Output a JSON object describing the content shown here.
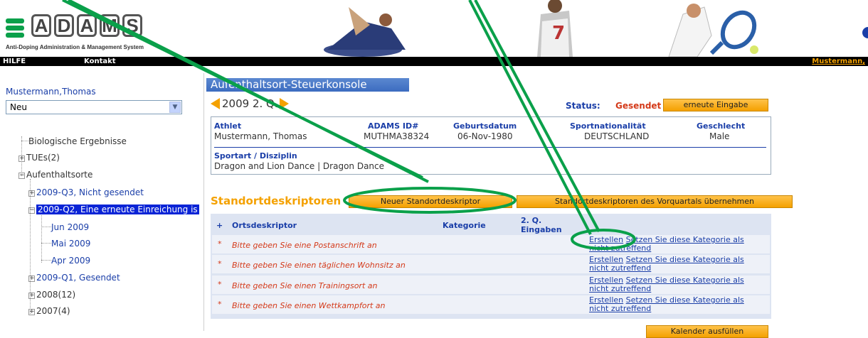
{
  "header": {
    "logo_letters": [
      "A",
      "D",
      "A",
      "M",
      "S"
    ],
    "logo_subtitle": "Anti-Doping Administration & Management System",
    "nav_help": "HILFE",
    "nav_contact": "Kontakt",
    "nav_user": "Mustermann,"
  },
  "sidebar": {
    "user_name": "Mustermann,Thomas",
    "status_select_value": "Neu",
    "tree": {
      "bio": "Biologische Ergebnisse",
      "tues": "TUEs(2)",
      "whereabouts": "Aufenthaltsorte",
      "q3": "2009-Q3, Nicht gesendet",
      "q2": "2009-Q2, Eine erneute Einreichung is",
      "jun": "Jun 2009",
      "mai": "Mai 2009",
      "apr": "Apr 2009",
      "q1": "2009-Q1, Gesendet",
      "y2008": "2008(12)",
      "y2007": "2007(4)"
    }
  },
  "main": {
    "title": "Aufenthaltsort-Steuerkonsole",
    "period": "2009 2. Q.",
    "status_label": "Status:",
    "status_value": "Gesendet",
    "resubmit_button": "erneute Eingabe",
    "athlete": {
      "h_athlete": "Athlet",
      "v_athlete": "Mustermann, Thomas",
      "h_id": "ADAMS ID#",
      "v_id": "MUTHMA38324",
      "h_dob": "Geburtsdatum",
      "v_dob": "06-Nov-1980",
      "h_nat": "Sportnationalität",
      "v_nat": "DEUTSCHLAND",
      "h_gender": "Geschlecht",
      "v_gender": "Male",
      "h_sport": "Sportart / Disziplin",
      "v_sport": "Dragon and Lion Dance | Dragon Dance"
    },
    "locations_title": "Standortdeskriptoren",
    "new_descriptor_button": "Neuer Standortdeskriptor",
    "copy_prev_button": "Standortdeskriptoren des Vorquartals übernehmen",
    "table": {
      "h_plus": "+",
      "h_desc": "Ortsdeskriptor",
      "h_cat": "Kategorie",
      "h_q_line1": "2. Q.",
      "h_q_line2": "Eingaben",
      "rows": [
        {
          "star": "*",
          "text": "Bitte geben Sie eine Postanschrift an"
        },
        {
          "star": "*",
          "text": "Bitte geben Sie einen täglichen Wohnsitz an"
        },
        {
          "star": "*",
          "text": "Bitte geben Sie einen Trainingsort an"
        },
        {
          "star": "*",
          "text": "Bitte geben Sie einen Wettkampfort an"
        }
      ],
      "action_create": "Erstellen",
      "action_na_1": "Setzen Sie diese Kategorie als",
      "action_na_2": "nicht zutreffend"
    },
    "calendar_button": "Kalender ausfüllen"
  },
  "colors": {
    "accent_orange": "#f4a100",
    "link_blue": "#1a3ea8",
    "alert_red": "#d43a1a",
    "annotation_green": "#0aa04a"
  }
}
